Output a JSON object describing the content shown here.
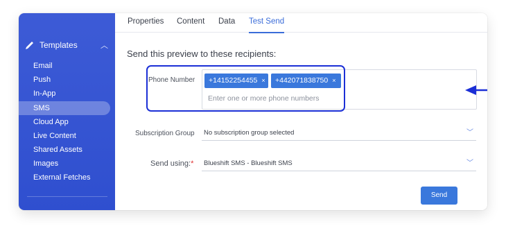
{
  "sidebar": {
    "section_label": "Templates",
    "items": [
      {
        "label": "Email"
      },
      {
        "label": "Push"
      },
      {
        "label": "In-App"
      },
      {
        "label": "SMS"
      },
      {
        "label": "Cloud App"
      },
      {
        "label": "Live Content"
      },
      {
        "label": "Shared Assets"
      },
      {
        "label": "Images"
      },
      {
        "label": "External Fetches"
      }
    ]
  },
  "tabs": [
    {
      "label": "Properties"
    },
    {
      "label": "Content"
    },
    {
      "label": "Data"
    },
    {
      "label": "Test Send"
    }
  ],
  "heading": "Send this preview to these recipients:",
  "phone": {
    "label": "Phone Number",
    "chips": [
      "+14152254455",
      "+442071838750"
    ],
    "chip_remove": "×",
    "placeholder": "Enter one or more phone numbers"
  },
  "subscription": {
    "label": "Subscription Group",
    "value": "No subscription group selected"
  },
  "send_using": {
    "label": "Send using:",
    "required_mark": "*",
    "value": "Blueshift SMS - Blueshift SMS"
  },
  "send_button": "Send",
  "colors": {
    "sidebar": "#3b5bdb",
    "accent": "#3a78dc",
    "annotation": "#1b2fd6"
  }
}
